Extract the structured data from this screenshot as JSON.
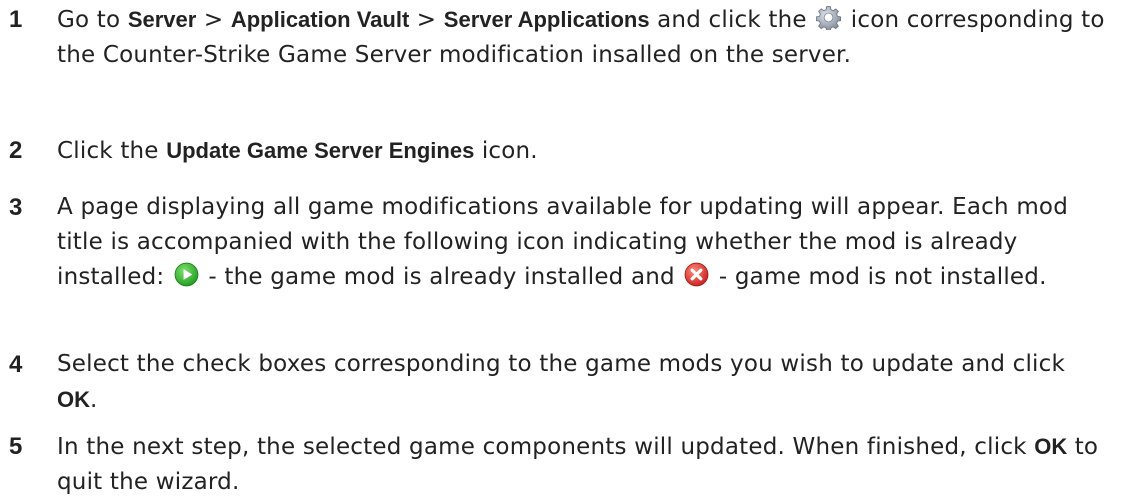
{
  "steps": [
    {
      "number": "1",
      "t1": "Go to ",
      "nav1": "Server",
      "sep1": " > ",
      "nav2": "Application Vault",
      "sep2": " > ",
      "nav3": "Server Applications",
      "t2": " and click the ",
      "t3": " icon corresponding to the Counter-Strike Game Server modification insalled on the server.",
      "icon": "gear-icon"
    },
    {
      "number": "2",
      "t1": "Click the ",
      "bold": "Update Game Server Engines",
      "t2": " icon."
    },
    {
      "number": "3",
      "t1": "A page displaying all game modifications available for updating will appear. Each mod title is accompanied with the following icon indicating whether the mod is already installed: ",
      "t2": " - the game mod is already installed and ",
      "t3": " - game mod is not installed.",
      "icon_installed": "green-play-icon",
      "icon_not_installed": "red-x-icon",
      "icon_installed_color": "#2db52d",
      "icon_not_installed_color": "#d93030"
    },
    {
      "number": "4",
      "t1": "Select the check boxes corresponding to the game mods you wish to update and click ",
      "bold": "OK",
      "t2": "."
    },
    {
      "number": "5",
      "t1": "In the next step, the selected game components will updated. When finished, click ",
      "bold": "OK",
      "t2": " to quit the wizard."
    }
  ]
}
